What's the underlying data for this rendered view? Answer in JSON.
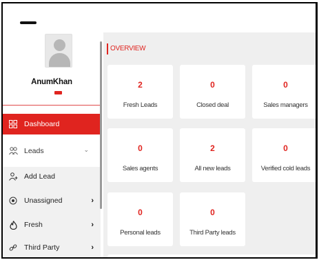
{
  "user": {
    "name": "AnumKhan"
  },
  "sidebar": {
    "dashboard": "Dashboard",
    "leads": "Leads",
    "submenu": [
      {
        "label": "Add Lead",
        "icon": "add-user-icon"
      },
      {
        "label": "Unassigned",
        "icon": "radio-target-icon"
      },
      {
        "label": "Fresh",
        "icon": "flame-icon"
      },
      {
        "label": "Third Party",
        "icon": "link-icon"
      }
    ]
  },
  "main": {
    "section_title": "OVERVIEW",
    "cards": [
      {
        "value": "2",
        "label": "Fresh Leads"
      },
      {
        "value": "0",
        "label": "Closed deal"
      },
      {
        "value": "0",
        "label": "Sales managers"
      },
      {
        "value": "0",
        "label": "Sales agents"
      },
      {
        "value": "2",
        "label": "All new leads"
      },
      {
        "value": "0",
        "label": "Verified cold leads"
      },
      {
        "value": "0",
        "label": "Personal leads"
      },
      {
        "value": "0",
        "label": "Third Party leads"
      }
    ]
  },
  "colors": {
    "accent": "#e0241f",
    "main_bg": "#efefef",
    "submenu_bg": "#f1f1f1"
  }
}
